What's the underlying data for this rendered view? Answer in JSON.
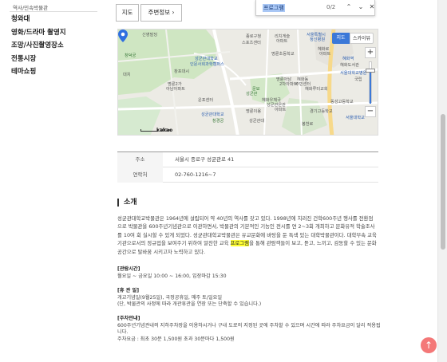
{
  "sidebar": {
    "sub_item": "역사/민속박물관",
    "items": [
      "청와대",
      "영화/드라마 촬영지",
      "조망/사진촬영장소",
      "전통시장",
      "테마쇼핑"
    ]
  },
  "tabs": {
    "map": "지도",
    "around": "주변정보",
    "around_arrow": "›"
  },
  "findbar": {
    "query": "프로그램",
    "count": "0/2"
  },
  "map": {
    "btn_map": "지도",
    "btn_skyview": "스카이뷰",
    "zoom_in": "+",
    "zoom_out": "−",
    "scale": "100m",
    "brand": "kakao",
    "labels": [
      "신영빌딩",
      "창덕궁",
      "종로구청",
      "스포츠센터",
      "리치게슬",
      "아파트",
      "서울특별시",
      "정신병원",
      "혜화로",
      "아파트",
      "명륜초등학교",
      "혜화역",
      "혜화도서관",
      "서울대학교병원",
      "성균관대학교",
      "인문사회과학캠퍼스",
      "문묘",
      "성균관",
      "명륜아남",
      "2차아파트",
      "혜화동",
      "주민센터",
      "혜화루터교회",
      "국립",
      "명륜2가",
      "아남아파트",
      "동성고등학교",
      "혜화우체국",
      "운포센터",
      "명륜이용",
      "성균관은관",
      "아파트",
      "성균관대학교",
      "경기고등학교",
      "창경궁",
      "창포대시",
      "성균관대",
      "서울대학교",
      "대치",
      "봉천로"
    ]
  },
  "info": {
    "rows": [
      {
        "key": "주소",
        "value": "서울시 종로구 성균관로 41"
      },
      {
        "key": "연락처",
        "value": "02-760-1216~7"
      }
    ]
  },
  "intro": {
    "title": "소개",
    "text_before": "성균관대학교박물관은 1964년에 설립되어 약 40년의 역사를 갖고 있다. 1998년에 치러진 건학600주년 행사를 전환점으로 박물관을 600주년기념관으로 이관하면서, 박물관의 기본적인 기능인 전시를 연 2~3회 개최하고 문화유적 학술조사를 10여 회 실시할 수 있게 되었다. 성균관대학교박물관은 유교문화에 바탕을 둔 특색 있는 대학박물관이다. 대학부속 교육기관으로서의 정규업을 보여주기 위하여 알찬한 교육 ",
    "text_highlight": "프로그램",
    "text_after": "을 통해 관람객들이 보고, 듣고, 느끼고, 감동할 수 있는 문화공간으로 탈바꿈 시키고자 노력하고 있다."
  },
  "hours": {
    "heading": "[관람시간]",
    "line1": "월요일 ~ 금요일 10:00 ~ 16:00, 입장마감 15:30"
  },
  "closed": {
    "heading": "[휴 관 일]",
    "line1": "개교기념일(9월25일), 국정공휴일, 매주 토/일요일",
    "line2": "(단, 박물관의 사정에 따라 개관휴관을 연장 또는 단축할 수 있습니다.)"
  },
  "parking": {
    "heading": "[주차안내]",
    "line1": "600주년기념관내의 지하주차장을 이용하시거나 구내 도로의 지정된 곳에 주차할 수 있으며 시간에 따라 주차요금이 달리 적용됩니다.",
    "line2": "주차요금 : 최초 30분 1,500원 초과 30분마다 1,500원"
  },
  "top_button": "↑"
}
